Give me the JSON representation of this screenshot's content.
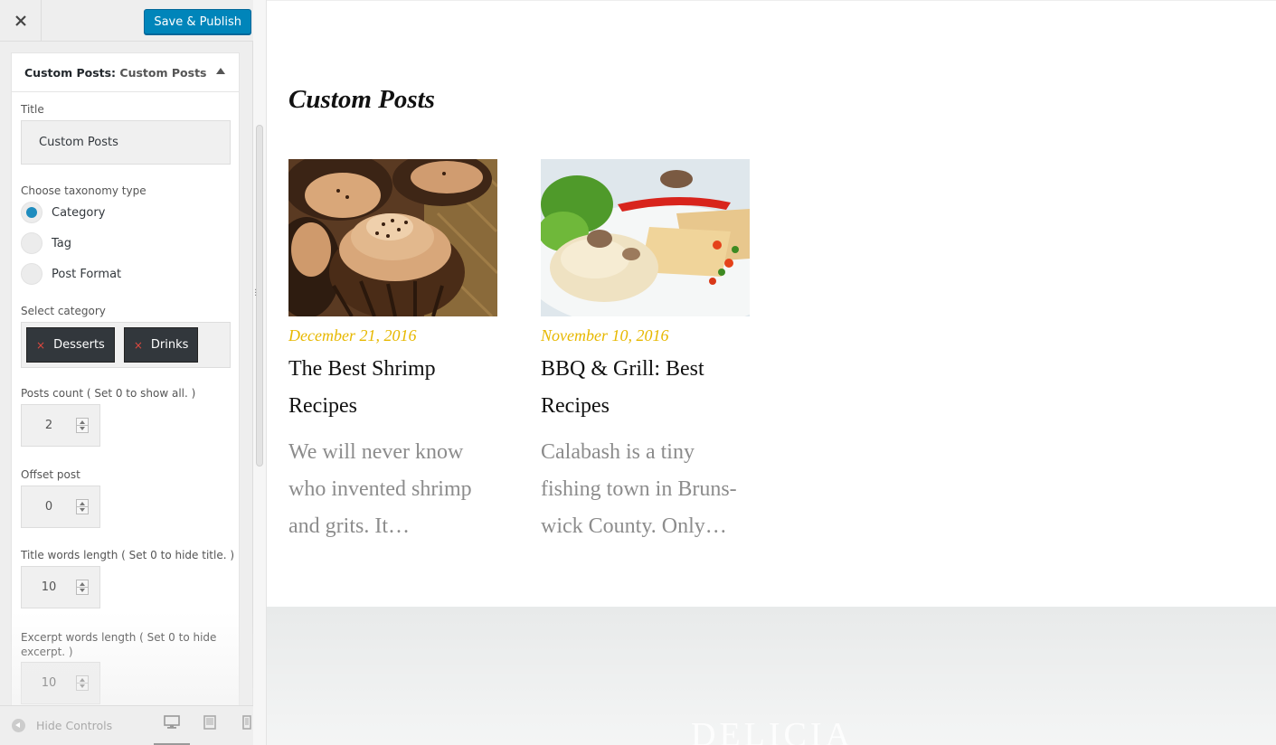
{
  "header": {
    "close_icon": "close-icon",
    "publish_label": "Save & Publish"
  },
  "widget": {
    "name": "Custom Posts:",
    "instance": "Custom Posts",
    "toggle_icon": "triangle-up-icon"
  },
  "form": {
    "title_label": "Title",
    "title_value": "Custom Posts",
    "taxonomy_label": "Choose taxonomy type",
    "taxonomy_options": [
      {
        "label": "Category",
        "checked": true
      },
      {
        "label": "Tag",
        "checked": false
      },
      {
        "label": "Post Format",
        "checked": false
      }
    ],
    "category_label": "Select category",
    "categories": [
      "Desserts",
      "Drinks"
    ],
    "tag_remove_glyph": "×",
    "posts_count_label": "Posts count ( Set 0 to show all. )",
    "posts_count_value": "2",
    "offset_label": "Offset post",
    "offset_value": "0",
    "title_words_label": "Title words length ( Set 0 to hide title. )",
    "title_words_value": "10",
    "excerpt_words_label": "Excerpt words length ( Set 0 to hide excerpt. )",
    "excerpt_words_value": "10"
  },
  "footer": {
    "hide_controls_label": "Hide Controls",
    "devices": [
      "desktop-icon",
      "tablet-icon",
      "mobile-icon"
    ],
    "active_device": "desktop"
  },
  "preview": {
    "widget_title": "Custom Posts",
    "posts": [
      {
        "date": "December 21, 2016",
        "title": "The Best Shrimp Recipes",
        "excerpt": "We will never know who invented shrimp and grits. It…",
        "image": "cupcakes-photo"
      },
      {
        "date": "November 10, 2016",
        "title": "BBQ & Grill: Best Recipes",
        "excerpt": "Calabash is a tiny fishing town in Bruns-wick County. Only…",
        "image": "crepe-plate-photo"
      }
    ],
    "footer_logo": "DELICIA"
  },
  "colors": {
    "publish_button": "#0085ba",
    "radio_checked": "#1e8cbe",
    "post_date": "#e7b800",
    "tag_chip": "#32373c",
    "tag_remove": "#e0483e"
  }
}
